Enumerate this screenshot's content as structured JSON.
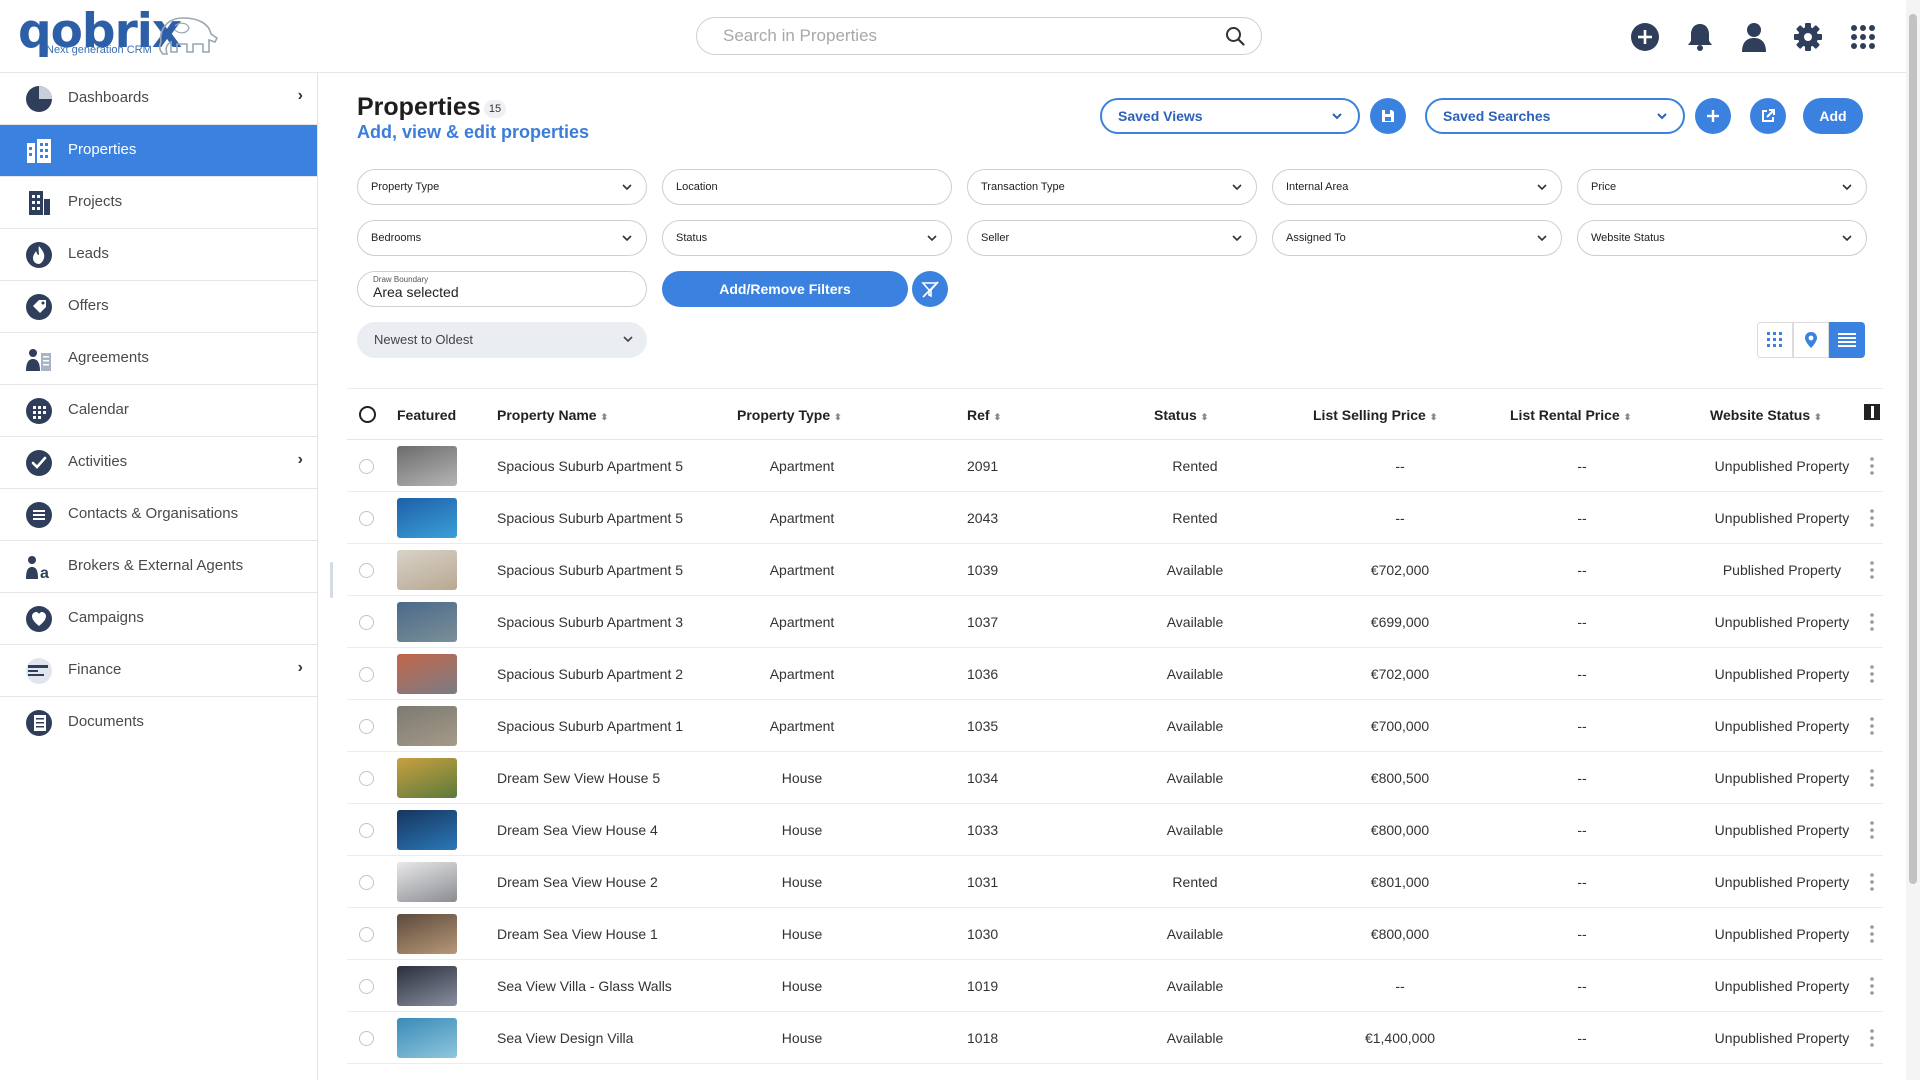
{
  "app": {
    "logo_word": "qobrix",
    "logo_tagline": "Next generation CRM"
  },
  "search": {
    "placeholder": "Search in Properties",
    "value": ""
  },
  "header_icons": [
    "add-circle-icon",
    "bell-icon",
    "user-icon",
    "gear-icon",
    "apps-grid-icon"
  ],
  "colors": {
    "accent": "#3b82e0",
    "nav_icon": "#2f3e5a",
    "link": "#3b7dd8"
  },
  "sidebar": {
    "items": [
      {
        "label": "Dashboards",
        "icon": "pie-chart-icon",
        "has_chevron": true
      },
      {
        "label": "Properties",
        "icon": "building-icon",
        "active": true
      },
      {
        "label": "Projects",
        "icon": "projects-icon"
      },
      {
        "label": "Leads",
        "icon": "flame-icon"
      },
      {
        "label": "Offers",
        "icon": "tag-icon"
      },
      {
        "label": "Agreements",
        "icon": "agreements-icon"
      },
      {
        "label": "Calendar",
        "icon": "calendar-icon"
      },
      {
        "label": "Activities",
        "icon": "check-circle-icon",
        "has_chevron": true
      },
      {
        "label": "Contacts & Organisations",
        "icon": "contacts-icon"
      },
      {
        "label": "Brokers & External Agents",
        "icon": "brokers-icon"
      },
      {
        "label": "Campaigns",
        "icon": "heart-icon"
      },
      {
        "label": "Finance",
        "icon": "finance-icon",
        "has_chevron": true
      },
      {
        "label": "Documents",
        "icon": "documents-icon"
      }
    ]
  },
  "page": {
    "title": "Properties",
    "count": "15",
    "subtitle": "Add, view & edit properties"
  },
  "toolbar": {
    "saved_views": "Saved Views",
    "saved_searches": "Saved Searches",
    "add_label": "Add"
  },
  "filters": {
    "property_type": "Property Type",
    "location": "Location",
    "transaction_type": "Transaction Type",
    "internal_area": "Internal Area",
    "price": "Price",
    "bedrooms": "Bedrooms",
    "status": "Status",
    "seller": "Seller",
    "assigned_to": "Assigned To",
    "website_status": "Website Status",
    "draw_boundary_label": "Draw Boundary",
    "draw_boundary_value": "Area selected",
    "add_remove_filters": "Add/Remove Filters",
    "sort": "Newest to Oldest"
  },
  "table": {
    "headers": {
      "featured": "Featured",
      "property_name": "Property Name",
      "property_type": "Property Type",
      "ref": "Ref",
      "status": "Status",
      "list_selling_price": "List Selling Price",
      "list_rental_price": "List Rental Price",
      "website_status": "Website Status"
    },
    "rows": [
      {
        "name": "Spacious Suburb Apartment 5",
        "type": "Apartment",
        "ref": "2091",
        "status": "Rented",
        "selling": "--",
        "rental": "--",
        "website": "Unpublished Property",
        "thumb": [
          "#6c6c6c",
          "#b5b5b5"
        ]
      },
      {
        "name": "Spacious Suburb Apartment 5",
        "type": "Apartment",
        "ref": "2043",
        "status": "Rented",
        "selling": "--",
        "rental": "--",
        "website": "Unpublished Property",
        "thumb": [
          "#1f5fa8",
          "#3aa0d8"
        ]
      },
      {
        "name": "Spacious Suburb Apartment 5",
        "type": "Apartment",
        "ref": "1039",
        "status": "Available",
        "selling": "€702,000",
        "rental": "--",
        "website": "Published Property",
        "thumb": [
          "#d8d2c8",
          "#b9a892"
        ]
      },
      {
        "name": "Spacious Suburb Apartment 3",
        "type": "Apartment",
        "ref": "1037",
        "status": "Available",
        "selling": "€699,000",
        "rental": "--",
        "website": "Unpublished Property",
        "thumb": [
          "#4a6a8a",
          "#7b8f96"
        ]
      },
      {
        "name": "Spacious Suburb Apartment 2",
        "type": "Apartment",
        "ref": "1036",
        "status": "Available",
        "selling": "€702,000",
        "rental": "--",
        "website": "Unpublished Property",
        "thumb": [
          "#c26548",
          "#7a7d86"
        ]
      },
      {
        "name": "Spacious Suburb Apartment 1",
        "type": "Apartment",
        "ref": "1035",
        "status": "Available",
        "selling": "€700,000",
        "rental": "--",
        "website": "Unpublished Property",
        "thumb": [
          "#7d7a72",
          "#a49a88"
        ]
      },
      {
        "name": "Dream Sew View House 5",
        "type": "House",
        "ref": "1034",
        "status": "Available",
        "selling": "€800,500",
        "rental": "--",
        "website": "Unpublished Property",
        "thumb": [
          "#c9a040",
          "#5b7a3c"
        ]
      },
      {
        "name": "Dream Sea View House 4",
        "type": "House",
        "ref": "1033",
        "status": "Available",
        "selling": "€800,000",
        "rental": "--",
        "website": "Unpublished Property",
        "thumb": [
          "#16355e",
          "#2b78b8"
        ]
      },
      {
        "name": "Dream Sea View House 2",
        "type": "House",
        "ref": "1031",
        "status": "Rented",
        "selling": "€801,000",
        "rental": "--",
        "website": "Unpublished Property",
        "thumb": [
          "#e8e8ea",
          "#8a8c90"
        ]
      },
      {
        "name": "Dream Sea View House 1",
        "type": "House",
        "ref": "1030",
        "status": "Available",
        "selling": "€800,000",
        "rental": "--",
        "website": "Unpublished Property",
        "thumb": [
          "#5c4a3c",
          "#b89878"
        ]
      },
      {
        "name": "Sea View Villa - Glass Walls",
        "type": "House",
        "ref": "1019",
        "status": "Available",
        "selling": "--",
        "rental": "--",
        "website": "Unpublished Property",
        "thumb": [
          "#2a2f3c",
          "#8a8fa0"
        ]
      },
      {
        "name": "Sea View Design Villa",
        "type": "House",
        "ref": "1018",
        "status": "Available",
        "selling": "€1,400,000",
        "rental": "--",
        "website": "Unpublished Property",
        "thumb": [
          "#3a8ab8",
          "#8fc6dc"
        ]
      }
    ]
  }
}
